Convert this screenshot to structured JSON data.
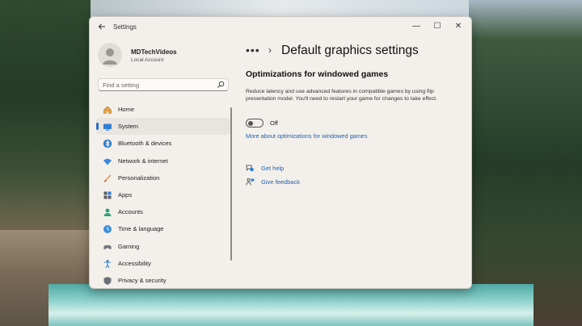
{
  "window": {
    "title": "Settings",
    "controls": {
      "minimize": "—",
      "maximize": "☐",
      "close": "✕"
    }
  },
  "profile": {
    "name": "MDTechVideos",
    "account_type": "Local Account"
  },
  "search": {
    "placeholder": "Find a setting"
  },
  "nav": {
    "items": [
      {
        "label": "Home",
        "icon": "home-icon"
      },
      {
        "label": "System",
        "icon": "system-icon",
        "active": true
      },
      {
        "label": "Bluetooth & devices",
        "icon": "bluetooth-icon"
      },
      {
        "label": "Network & internet",
        "icon": "network-icon"
      },
      {
        "label": "Personalization",
        "icon": "personalization-icon"
      },
      {
        "label": "Apps",
        "icon": "apps-icon"
      },
      {
        "label": "Accounts",
        "icon": "accounts-icon"
      },
      {
        "label": "Time & language",
        "icon": "time-language-icon"
      },
      {
        "label": "Gaming",
        "icon": "gaming-icon"
      },
      {
        "label": "Accessibility",
        "icon": "accessibility-icon"
      },
      {
        "label": "Privacy & security",
        "icon": "privacy-icon"
      }
    ]
  },
  "content": {
    "breadcrumb_more": "•••",
    "breadcrumb_sep": "›",
    "page_title": "Default graphics settings",
    "section_title": "Optimizations for windowed games",
    "description": "Reduce latency and use advanced features in compatible games by using flip presentation model. You'll need to restart your game for changes to take effect.",
    "toggle": {
      "state": "Off",
      "on": false
    },
    "more_link": "More about optimizations for windowed games",
    "help": {
      "get_help": "Get help",
      "give_feedback": "Give feedback"
    }
  },
  "colors": {
    "accent": "#2b6fc4",
    "link": "#1f5fb3",
    "window_bg": "#f3f0eb"
  }
}
